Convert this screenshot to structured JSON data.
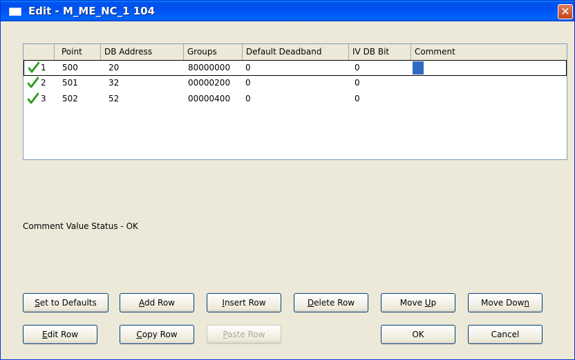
{
  "window": {
    "title": "Edit - M_ME_NC_1 104",
    "close_glyph": "✕"
  },
  "table": {
    "columns": [
      "",
      "Point",
      "DB Address",
      "Groups",
      "Default Deadband",
      "IV DB Bit",
      "Comment"
    ],
    "rows": [
      {
        "index": "1",
        "point": "500",
        "db_address": "20",
        "groups": "80000000",
        "default_deadband": "0",
        "iv_db_bit": "0",
        "comment": ""
      },
      {
        "index": "2",
        "point": "501",
        "db_address": "32",
        "groups": "00000200",
        "default_deadband": "0",
        "iv_db_bit": "0",
        "comment": ""
      },
      {
        "index": "3",
        "point": "502",
        "db_address": "52",
        "groups": "00000400",
        "default_deadband": "0",
        "iv_db_bit": "0",
        "comment": ""
      }
    ],
    "row_status_icon": "checkmark-icon",
    "check_color": "#2e9e1f",
    "selection_color": "#316ac5"
  },
  "status_text": "Comment Value Status - OK",
  "buttons": {
    "set_defaults": {
      "pre": "",
      "key": "S",
      "post": "et to Defaults"
    },
    "add_row": {
      "pre": "",
      "key": "A",
      "post": "dd Row"
    },
    "insert_row": {
      "pre": "",
      "key": "I",
      "post": "nsert Row"
    },
    "delete_row": {
      "pre": "",
      "key": "D",
      "post": "elete Row"
    },
    "move_up": {
      "pre": "Move ",
      "key": "U",
      "post": "p"
    },
    "move_down": {
      "pre": "Move Dow",
      "key": "n",
      "post": ""
    },
    "edit_row": {
      "pre": "",
      "key": "E",
      "post": "dit Row"
    },
    "copy_row": {
      "pre": "",
      "key": "C",
      "post": "opy Row"
    },
    "paste_row": {
      "pre": "",
      "key": "P",
      "post": "aste Row"
    },
    "ok": {
      "pre": "OK",
      "key": "",
      "post": ""
    },
    "cancel": {
      "pre": "Cancel",
      "key": "",
      "post": ""
    }
  }
}
